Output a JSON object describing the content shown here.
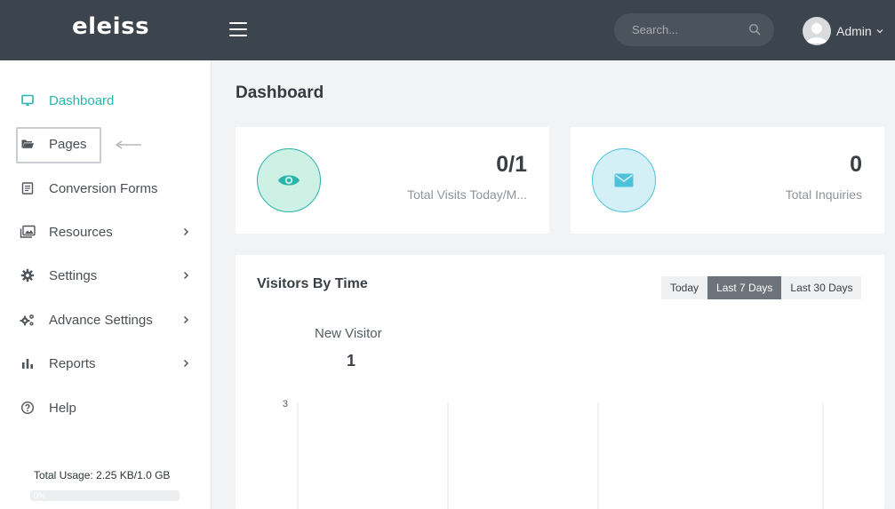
{
  "app": {
    "logo": "eleiss"
  },
  "header": {
    "search_placeholder": "Search...",
    "user_name": "Admin"
  },
  "sidebar": {
    "items": [
      {
        "label": "Dashboard",
        "icon": "monitor-icon",
        "active": true
      },
      {
        "label": "Pages",
        "icon": "folder-icon"
      },
      {
        "label": "Conversion Forms",
        "icon": "form-icon"
      },
      {
        "label": "Resources",
        "icon": "images-icon",
        "submenu": true
      },
      {
        "label": "Settings",
        "icon": "gear-icon",
        "submenu": true
      },
      {
        "label": "Advance Settings",
        "icon": "gears-icon",
        "submenu": true
      },
      {
        "label": "Reports",
        "icon": "bar-chart-icon",
        "submenu": true
      },
      {
        "label": "Help",
        "icon": "question-circle-icon"
      }
    ],
    "usage_label": "Total Usage: 2.25 KB/1.0 GB",
    "usage_percent_label": "0%",
    "usage_fraction": 0.0
  },
  "main": {
    "title": "Dashboard",
    "stats": [
      {
        "value": "0/1",
        "label": "Total Visits Today/M...",
        "icon": "eye-icon"
      },
      {
        "value": "0",
        "label": "Total Inquiries",
        "icon": "envelope-icon"
      }
    ],
    "chart": {
      "title": "Visitors By Time",
      "ranges": [
        "Today",
        "Last 7 Days",
        "Last 30 Days"
      ],
      "selected_range": "Last 7 Days",
      "summary_label": "New Visitor",
      "summary_value": "1",
      "y_tick_top": "3"
    }
  },
  "colors": {
    "accent": "#2ab3ad",
    "topbar": "#3c444d",
    "eye_circle": "#cdf1e4",
    "envelope_circle": "#d4f0f6"
  }
}
